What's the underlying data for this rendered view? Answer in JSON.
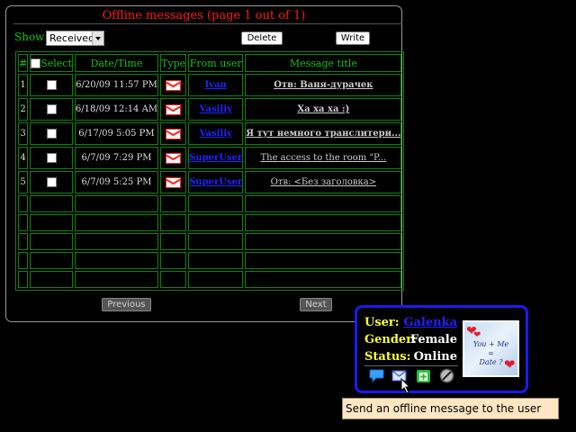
{
  "panel": {
    "title": "Offline messages (page 1 out of 1)",
    "show_label": "Show:",
    "show_value": "Received",
    "delete_label": "Delete",
    "write_label": "Write",
    "previous_label": "Previous",
    "next_label": "Next"
  },
  "table": {
    "headers": {
      "num": "#",
      "select": "Select",
      "date": "Date/Time",
      "type": "Type",
      "from": "From user",
      "title": "Message title"
    },
    "rows": [
      {
        "num": "1",
        "date": "6/20/09 11:57 PM",
        "type_icon": "envelope-icon",
        "from": "Ivan",
        "title": "Отв: Ваня-дурачек"
      },
      {
        "num": "2",
        "date": "6/18/09 12:14 AM",
        "type_icon": "envelope-icon",
        "from": "Vasiliy",
        "title": "Ха ха ха :)"
      },
      {
        "num": "3",
        "date": "6/17/09 5:05 PM",
        "type_icon": "envelope-icon",
        "from": "Vasiliy",
        "title": "Я тут немного транслитери..."
      },
      {
        "num": "4",
        "date": "6/7/09 7:29 PM",
        "type_icon": "envelope-icon",
        "from": "SuperUser",
        "title": "The access to the room \"P..."
      },
      {
        "num": "5",
        "date": "6/7/09 5:25 PM",
        "type_icon": "envelope-icon",
        "from": "SuperUser",
        "title": "Отв: <Без заголовка>"
      }
    ]
  },
  "user_card": {
    "user_label": "User:",
    "user_value": "Galenka",
    "gender_label": "Gender:",
    "gender_value": "Female",
    "status_label": "Status:",
    "status_value": "Online",
    "picture_text_1": "You + Me",
    "picture_text_2": "=",
    "picture_text_3": "Date ?",
    "actions": [
      "chat-bubble-icon",
      "envelope-icon",
      "add-contact-icon",
      "block-icon"
    ]
  },
  "tooltip": "Send an offline message to the user",
  "colors": {
    "title_red": "#ff1a1a",
    "label_green": "#19c219",
    "table_border": "#128212",
    "link_blue": "#2222ff",
    "card_border": "#1a1aee",
    "card_label": "#ffff33",
    "tooltip_bg": "#ffe7c4"
  }
}
